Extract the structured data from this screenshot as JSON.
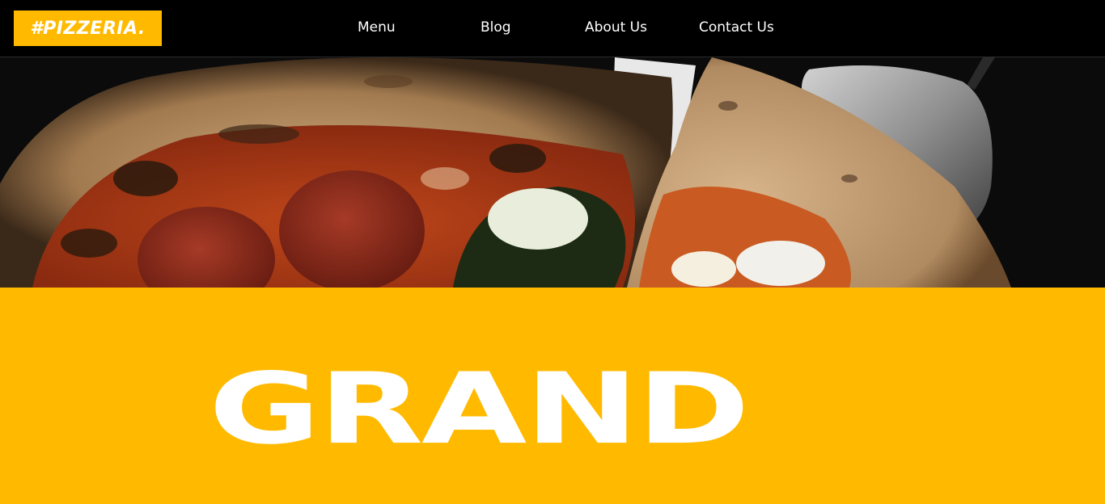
{
  "header": {
    "logo_text": "#PIZZERIA.",
    "nav": [
      {
        "label": "Menu"
      },
      {
        "label": "Blog"
      },
      {
        "label": "About Us"
      },
      {
        "label": "Contact Us"
      }
    ]
  },
  "hero": {
    "image_icon": "pizza-photo"
  },
  "main": {
    "title": "GRAND"
  },
  "colors": {
    "accent": "#ffba00",
    "header_bg": "#000000",
    "text": "#ffffff"
  }
}
